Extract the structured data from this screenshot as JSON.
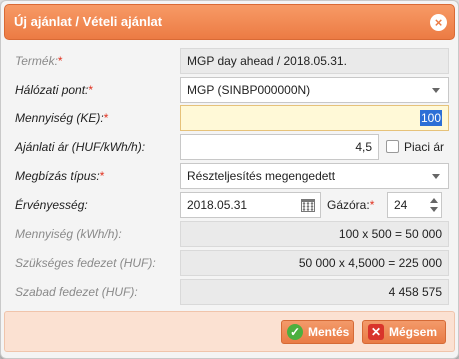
{
  "dialog": {
    "title": "Új ajánlat / Vételi ajánlat",
    "close_icon": "×"
  },
  "fields": {
    "termek": {
      "label": "Termék:",
      "required": "*",
      "value": "MGP day ahead / 2018.05.31."
    },
    "halozati_pont": {
      "label": "Hálózati pont:",
      "required": "*",
      "value": "MGP (SINBP000000N)"
    },
    "mennyiseg_ke": {
      "label": "Mennyiség (KE):",
      "required": "*",
      "value": "100"
    },
    "ajanlati_ar": {
      "label": "Ajánlati ár (HUF/kWh/h):",
      "value": "4,5",
      "checkbox_label": "Piaci ár",
      "checked": false
    },
    "megbizas_tipus": {
      "label": "Megbízás típus:",
      "required": "*",
      "value": "Részteljesítés megengedett"
    },
    "ervenyesseg": {
      "label": "Érvényesség:",
      "date": "2018.05.31",
      "hour_label": "Gázóra:",
      "hour_required": "*",
      "hour_value": "24"
    },
    "mennyiseg_kwh": {
      "label": "Mennyiség (kWh/h):",
      "value": "100 x 500 = 50 000"
    },
    "szukseges_fedezet": {
      "label": "Szükséges fedezet (HUF):",
      "value": "50 000 x 4,5000 = 225 000"
    },
    "szabad_fedezet": {
      "label": "Szabad fedezet (HUF):",
      "value": "4 458 575"
    }
  },
  "buttons": {
    "save": "Mentés",
    "cancel": "Mégsem"
  }
}
